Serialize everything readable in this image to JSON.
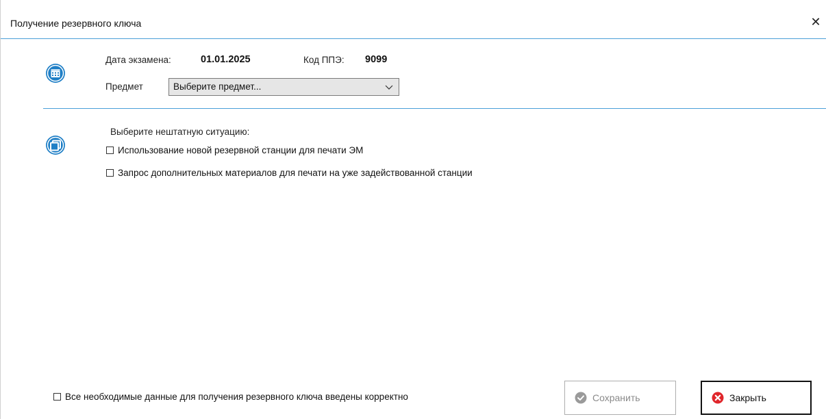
{
  "window": {
    "title": "Получение резервного ключа",
    "close_glyph": "✕"
  },
  "exam": {
    "date_label": "Дата экзамена:",
    "date_value": "01.01.2025",
    "ppe_label": "Код ППЭ:",
    "ppe_value": "9099",
    "subject_label": "Предмет",
    "subject_selected": "Выберите предмет..."
  },
  "situation": {
    "prompt": "Выберите нештатную ситуацию:",
    "options": [
      {
        "label": "Использование новой резервной станции для печати ЭМ",
        "checked": false
      },
      {
        "label": "Запрос дополнительных материалов для печати на уже задействованной станции",
        "checked": false
      }
    ]
  },
  "footer": {
    "confirm_label": "Все необходимые данные для получения резервного ключа введены корректно",
    "confirm_checked": false,
    "save_label": "Сохранить",
    "save_enabled": false,
    "close_label": "Закрыть"
  },
  "icons": {
    "calendar": "calendar-icon",
    "copy": "copy-window-icon",
    "save": "check-circle-icon",
    "close": "error-x-circle-icon"
  },
  "colors": {
    "accent": "#1f7fc6",
    "divider": "#4a9fd8",
    "close_red": "#e0262b",
    "disabled_gray": "#9a9a9a"
  }
}
